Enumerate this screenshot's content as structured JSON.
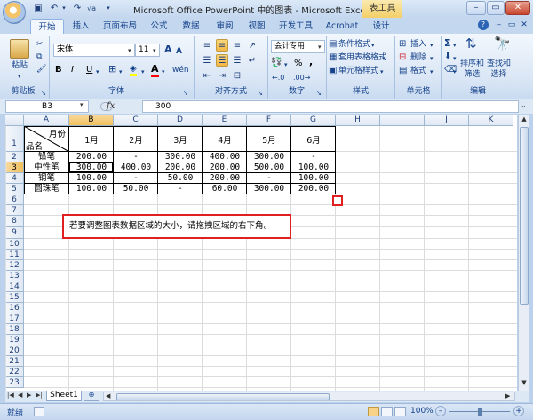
{
  "window": {
    "title": "Microsoft Office PowerPoint 中的图表 - Microsoft Excel",
    "context_tab": "表工具"
  },
  "tabs": [
    "开始",
    "插入",
    "页面布局",
    "公式",
    "数据",
    "审阅",
    "视图",
    "开发工具",
    "Acrobat",
    "设计"
  ],
  "ribbon": {
    "clipboard": {
      "paste": "粘贴",
      "label": "剪贴板"
    },
    "font": {
      "name": "宋体",
      "size": "11",
      "bold": "B",
      "italic": "I",
      "underline": "U",
      "grow": "A",
      "shrink": "A",
      "phonetic": "wén",
      "label": "字体"
    },
    "alignment": {
      "label": "对齐方式"
    },
    "number": {
      "format": "会计专用",
      "percent": "%",
      "comma": ",",
      "label": "数字"
    },
    "styles": {
      "conditional": "条件格式",
      "table": "套用表格格式",
      "cell": "单元格样式",
      "label": "样式"
    },
    "cells": {
      "insert": "插入",
      "delete": "删除",
      "format": "格式",
      "label": "单元格"
    },
    "editing": {
      "sort": "排序和\n筛选",
      "find": "查找和\n选择",
      "label": "编辑"
    }
  },
  "formula_bar": {
    "name_box": "B3",
    "fx": "fx",
    "value": "300"
  },
  "sheet": {
    "columns": [
      "A",
      "B",
      "C",
      "D",
      "E",
      "F",
      "G",
      "H",
      "I",
      "J",
      "K"
    ],
    "selected_col": "B",
    "selected_row": "3",
    "rows": [
      "1",
      "2",
      "3",
      "4",
      "5",
      "6",
      "7",
      "8",
      "9",
      "10",
      "11",
      "12",
      "13",
      "14",
      "15",
      "16",
      "17",
      "18",
      "19",
      "20",
      "21",
      "22",
      "23"
    ],
    "header_month": "月份",
    "header_item": "品名",
    "months": [
      "1月",
      "2月",
      "3月",
      "4月",
      "5月",
      "6月"
    ],
    "data_rows": [
      {
        "name": "铅笔",
        "values": [
          "200.00",
          "-",
          "300.00",
          "400.00",
          "300.00",
          "-"
        ]
      },
      {
        "name": "中性笔",
        "values": [
          "300.00",
          "400.00",
          "200.00",
          "200.00",
          "500.00",
          "100.00"
        ]
      },
      {
        "name": "钢笔",
        "values": [
          "100.00",
          "-",
          "50.00",
          "200.00",
          "-",
          "100.00"
        ]
      },
      {
        "name": "圆珠笔",
        "values": [
          "100.00",
          "50.00",
          "-",
          "60.00",
          "300.00",
          "200.00"
        ]
      }
    ],
    "note": "若要调整图表数据区域的大小，请拖拽区域的右下角。"
  },
  "sheet_tabs": [
    "Sheet1"
  ],
  "status": {
    "ready": "就绪",
    "zoom": "100%"
  }
}
